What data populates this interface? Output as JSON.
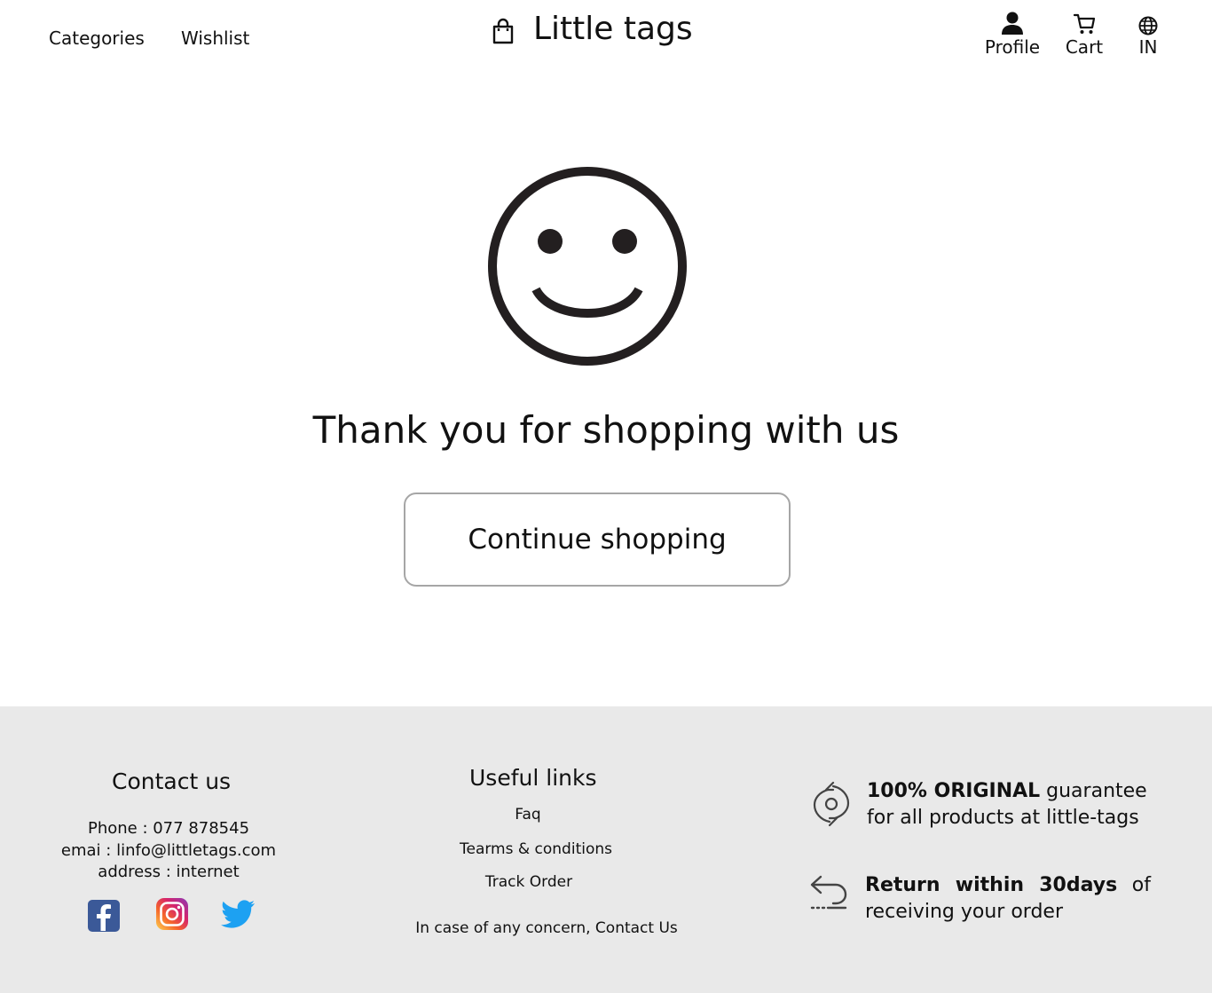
{
  "header": {
    "nav": {
      "categories": "Categories",
      "wishlist": "Wishlist"
    },
    "brand": {
      "name": "Little tags",
      "icon": "shopping-bag-icon"
    },
    "actions": {
      "profile": {
        "label": "Profile",
        "icon": "person-icon"
      },
      "cart": {
        "label": "Cart",
        "icon": "cart-icon"
      },
      "region": {
        "label": "IN",
        "icon": "globe-icon"
      }
    }
  },
  "main": {
    "icon": "smiley-face-icon",
    "message": "Thank you for shopping with us",
    "continue_label": "Continue shopping"
  },
  "footer": {
    "background": "#e9e9e9",
    "contact": {
      "title": "Contact us",
      "phone": "Phone  : 077 878545",
      "email": "emai : linfo@littletags.com",
      "address": "address : internet",
      "social": [
        "facebook-icon",
        "instagram-icon",
        "twitter-icon"
      ]
    },
    "links": {
      "title": "Useful links",
      "items": [
        "Faq",
        "Tearms & conditions",
        "Track Order"
      ],
      "concern": "In case of any concern, Contact Us"
    },
    "features": [
      {
        "icon": "original-guarantee-icon",
        "bold": "100% ORIGINAL",
        "text": " guarantee for all products at little-tags"
      },
      {
        "icon": "return-icon",
        "bold": "Return within 30days",
        "text": " of receiving your order"
      }
    ]
  },
  "colors": {
    "text": "#111111",
    "button_border": "#a6a6a6",
    "facebook": "#3b5998",
    "twitter": "#1da1f2"
  }
}
